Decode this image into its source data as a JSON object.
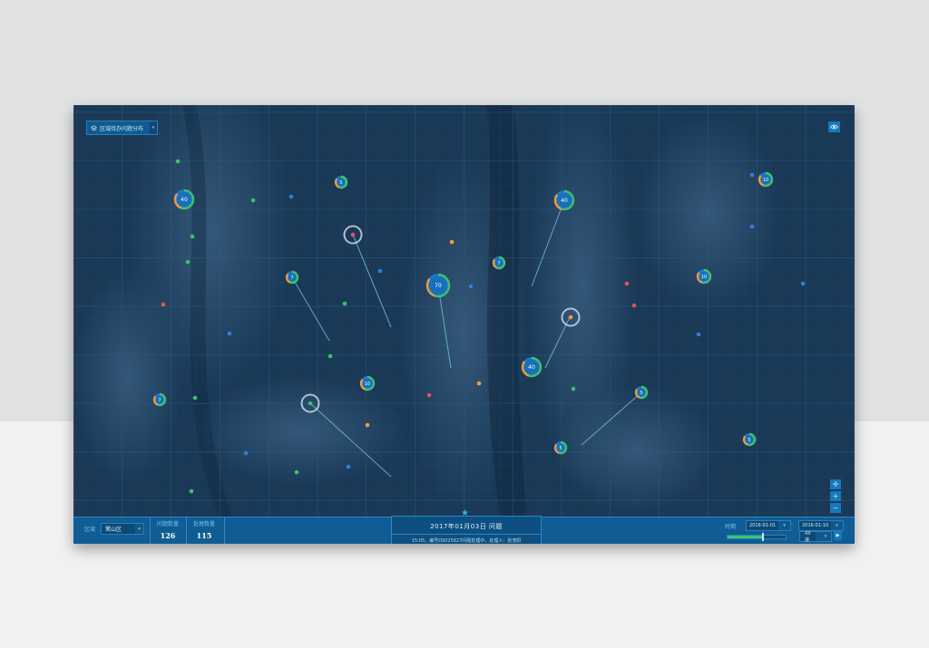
{
  "layer_selector": {
    "label": "区域待办问题分布",
    "arrow": "▾"
  },
  "region": {
    "label": "区域",
    "value": "鹭山区",
    "arrow": "▾"
  },
  "stats": [
    {
      "label": "问题数量",
      "value": "126"
    },
    {
      "label": "处理数量",
      "value": "115"
    }
  ],
  "event_panel": {
    "title": "2017年01月03日  问题",
    "description": "15:05，编号DS025627问题处理中，处理人：张浩阳"
  },
  "time_range": {
    "label": "时期",
    "start": "2016-01-01",
    "separator": "-",
    "end": "2016-01-10",
    "arrow": "▾",
    "progress": 0.6,
    "speed": "4X 速",
    "speed_arrow": "▾"
  },
  "zoom": {
    "pan": "✛",
    "in": "+",
    "out": "−"
  },
  "markers": {
    "clusters": [
      {
        "count": "40",
        "color": "#2f8fe0"
      },
      {
        "count": "5",
        "color": "#2f8fe0"
      },
      {
        "count": "40",
        "color": "#2f8fe0"
      },
      {
        "count": "10",
        "color": "#2f8fe0"
      },
      {
        "count": "7",
        "color": "#2f8fe0"
      },
      {
        "count": "70",
        "color": "#2f8fe0"
      },
      {
        "count": "7",
        "color": "#2f8fe0"
      },
      {
        "count": "10",
        "color": "#2f8fe0"
      },
      {
        "count": "10",
        "color": "#2f8fe0"
      },
      {
        "count": "40",
        "color": "#2f8fe0"
      },
      {
        "count": "7",
        "color": "#2f8fe0"
      },
      {
        "count": "5",
        "color": "#2f8fe0"
      },
      {
        "count": "5",
        "color": "#2f8fe0"
      },
      {
        "count": "5",
        "color": "#2f8fe0"
      }
    ],
    "dot_colors": {
      "green": "#3ec26a",
      "blue": "#2f7fd6",
      "red": "#e0574c",
      "orange": "#f39a3a"
    }
  },
  "colors": {
    "map_bg": "#15324f",
    "bar_bg": "#0f5d94",
    "accent": "#2fb0f0"
  }
}
